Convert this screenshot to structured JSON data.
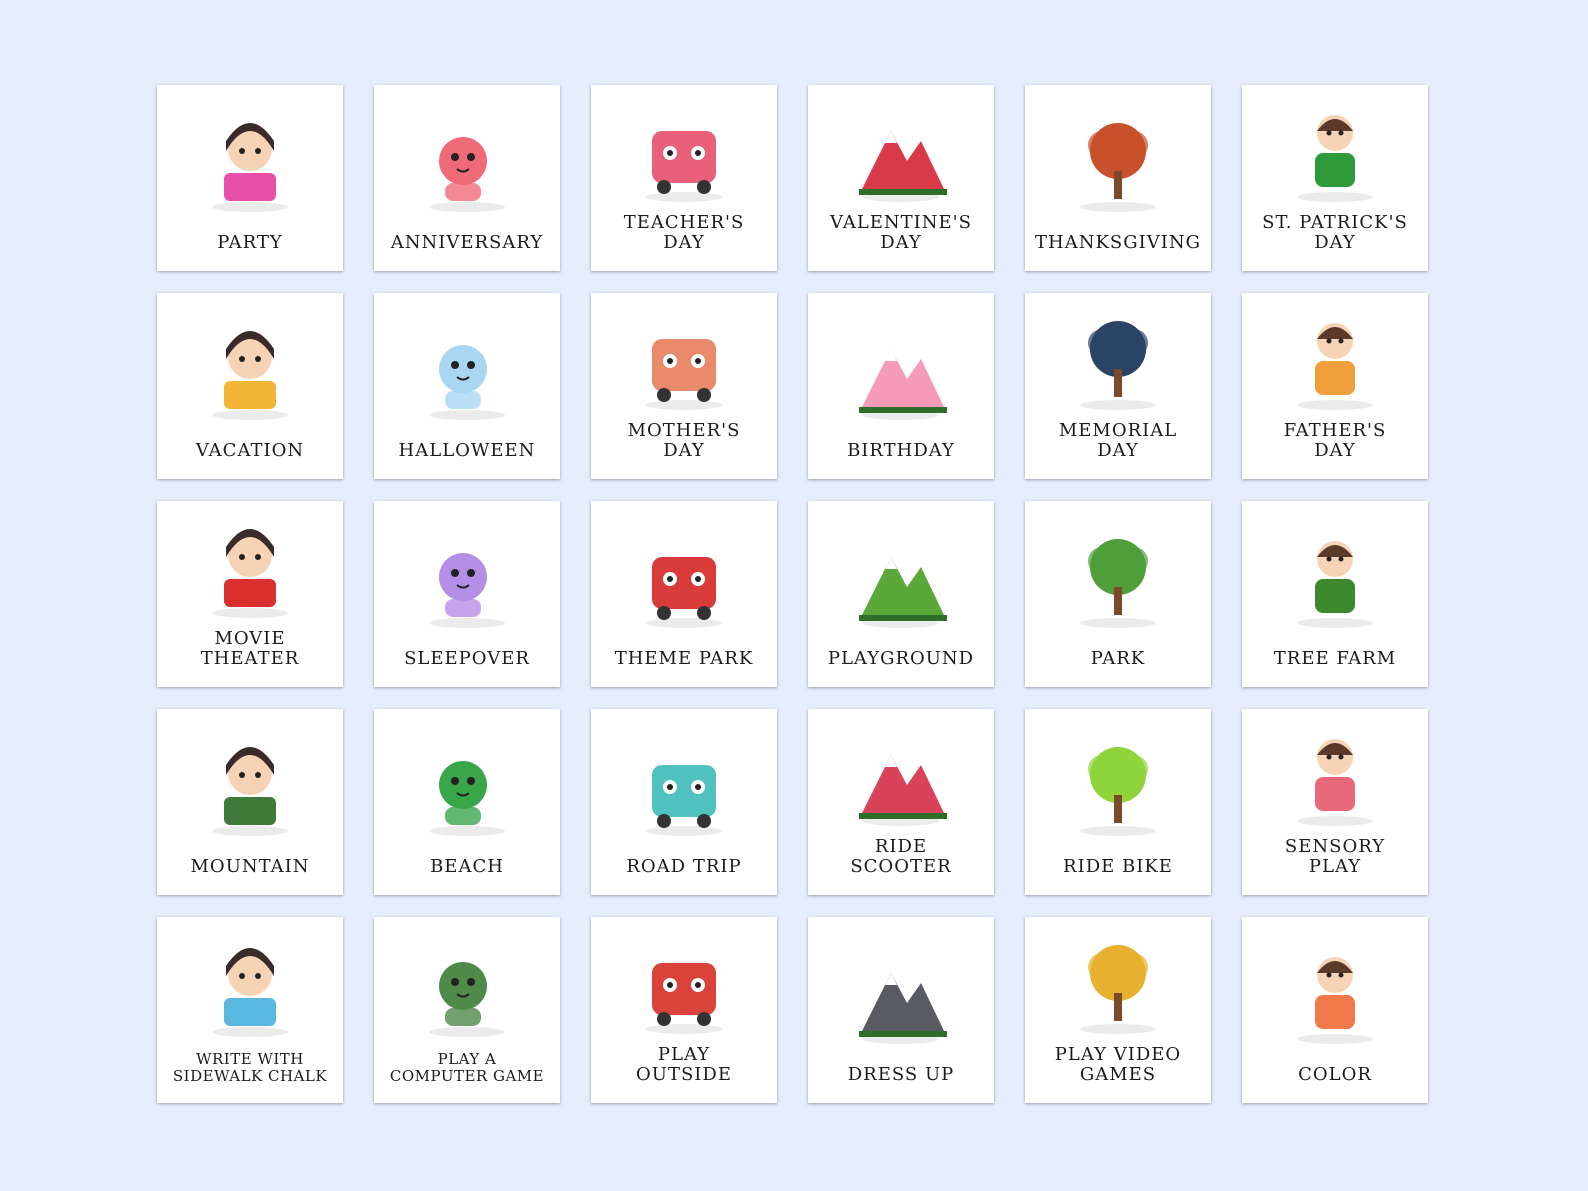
{
  "cards": [
    {
      "label": "PARTY",
      "icon": "dj-girl-icon",
      "color": "#e84fa8"
    },
    {
      "label": "ANNIVERSARY",
      "icon": "kitten-balloon-icon",
      "color": "#f06b7a"
    },
    {
      "label": "TEACHER'S\nDAY",
      "icon": "teacher-icon",
      "color": "#e8607a"
    },
    {
      "label": "VALENTINE'S\nDAY",
      "icon": "cat-rose-icon",
      "color": "#d93a4a"
    },
    {
      "label": "THANKSGIVING",
      "icon": "turkey-icon",
      "color": "#c8502a"
    },
    {
      "label": "ST. PATRICK'S\nDAY",
      "icon": "leprechaun-icon",
      "color": "#2e9a3a"
    },
    {
      "label": "VACATION",
      "icon": "umbrella-cat-icon",
      "color": "#f2b536"
    },
    {
      "label": "HALLOWEEN",
      "icon": "ghost-icon",
      "color": "#a9d6f0"
    },
    {
      "label": "MOTHER'S\nDAY",
      "icon": "mother-children-icon",
      "color": "#e98a6b"
    },
    {
      "label": "BIRTHDAY",
      "icon": "cake-icon",
      "color": "#f59ab8"
    },
    {
      "label": "MEMORIAL\nDAY",
      "icon": "soldier-salute-icon",
      "color": "#2b4466"
    },
    {
      "label": "FATHER'S\nDAY",
      "icon": "father-son-icon",
      "color": "#f0a03a"
    },
    {
      "label": "MOVIE\nTHEATER",
      "icon": "popcorn-clapper-icon",
      "color": "#d9302f"
    },
    {
      "label": "SLEEPOVER",
      "icon": "rainbow-clouds-icon",
      "color": "#b58ee6"
    },
    {
      "label": "THEME PARK",
      "icon": "ferris-wheel-icon",
      "color": "#d93a3a"
    },
    {
      "label": "PLAYGROUND",
      "icon": "playground-icon",
      "color": "#5aa83a"
    },
    {
      "label": "PARK",
      "icon": "park-tree-icon",
      "color": "#4f9e3a"
    },
    {
      "label": "TREE FARM",
      "icon": "apple-tree-icon",
      "color": "#3d8a2e"
    },
    {
      "label": "MOUNTAIN",
      "icon": "mountain-icon",
      "color": "#3f7a3a"
    },
    {
      "label": "BEACH",
      "icon": "palm-beach-icon",
      "color": "#3aa64a"
    },
    {
      "label": "ROAD TRIP",
      "icon": "camper-van-icon",
      "color": "#4fc2c0"
    },
    {
      "label": "RIDE\nSCOOTER",
      "icon": "scooter-kid-icon",
      "color": "#d9435a"
    },
    {
      "label": "RIDE BIKE",
      "icon": "bicycle-icon",
      "color": "#8ed43a"
    },
    {
      "label": "SENSORY\nPLAY",
      "icon": "sensory-table-icon",
      "color": "#e86a7a"
    },
    {
      "label": "WRITE WITH\nSIDEWALK CHALK",
      "icon": "chalk-bucket-icon",
      "color": "#5ab8e0",
      "small": true
    },
    {
      "label": "PLAY A\nCOMPUTER GAME",
      "icon": "gamer-computer-icon",
      "color": "#4f8a4a",
      "small": true
    },
    {
      "label": "PLAY\nOUTSIDE",
      "icon": "bunny-slide-icon",
      "color": "#d9433a"
    },
    {
      "label": "DRESS UP",
      "icon": "business-girl-icon",
      "color": "#5a5a62"
    },
    {
      "label": "PLAY VIDEO\nGAMES",
      "icon": "video-gamer-icon",
      "color": "#e8b030"
    },
    {
      "label": "COLOR",
      "icon": "crayon-cup-icon",
      "color": "#f07a4a"
    }
  ]
}
